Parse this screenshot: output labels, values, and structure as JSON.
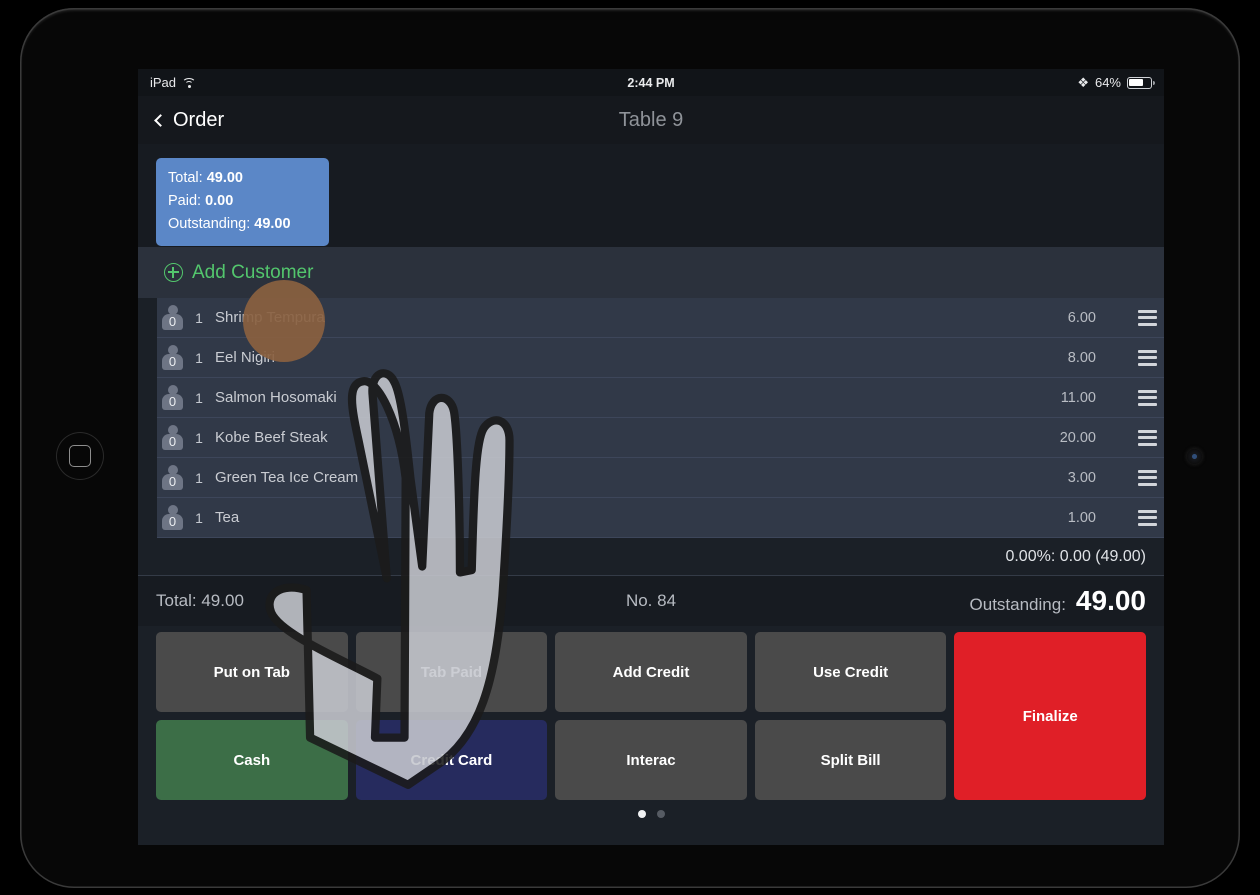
{
  "status_bar": {
    "device": "iPad",
    "wifi_icon": "wifi-icon",
    "time": "2:44 PM",
    "bluetooth_icon": "bluetooth-icon",
    "battery_percent": "64%",
    "battery_icon": "battery-icon"
  },
  "nav_bar": {
    "back_icon": "chevron-left-icon",
    "back_label": "Order",
    "title": "Table 9"
  },
  "totals_box": {
    "total_label": "Total:",
    "total_value": "49.00",
    "paid_label": "Paid:",
    "paid_value": "0.00",
    "outstanding_label": "Outstanding:",
    "outstanding_value": "49.00",
    "color": "#5b87c7"
  },
  "add_customer": {
    "icon": "plus-circle-icon",
    "label": "Add Customer",
    "color": "#53c66d"
  },
  "order_items": [
    {
      "seat": "0",
      "qty": "1",
      "name": "Shrimp Tempura",
      "price": "6.00",
      "menu_icon": "hamburger-menu-icon"
    },
    {
      "seat": "0",
      "qty": "1",
      "name": "Eel Nigiri",
      "price": "8.00",
      "menu_icon": "hamburger-menu-icon"
    },
    {
      "seat": "0",
      "qty": "1",
      "name": "Salmon Hosomaki",
      "price": "11.00",
      "menu_icon": "hamburger-menu-icon"
    },
    {
      "seat": "0",
      "qty": "1",
      "name": "Kobe Beef Steak",
      "price": "20.00",
      "menu_icon": "hamburger-menu-icon"
    },
    {
      "seat": "0",
      "qty": "1",
      "name": "Green Tea Ice Cream",
      "price": "3.00",
      "menu_icon": "hamburger-menu-icon"
    },
    {
      "seat": "0",
      "qty": "1",
      "name": "Tea",
      "price": "1.00",
      "menu_icon": "hamburger-menu-icon"
    }
  ],
  "tax_row": "0.00%: 0.00 (49.00)",
  "summary": {
    "total": "Total: 49.00",
    "order_number": "No. 84",
    "outstanding_label": "Outstanding:",
    "outstanding_value": "49.00"
  },
  "buttons": [
    {
      "label": "Put on Tab",
      "style": "grey"
    },
    {
      "label": "Tab Paid",
      "style": "grey"
    },
    {
      "label": "Add Credit",
      "style": "grey"
    },
    {
      "label": "Use Credit",
      "style": "grey"
    },
    {
      "label": "Finalize",
      "style": "finalize"
    },
    {
      "label": "Cash",
      "style": "cash"
    },
    {
      "label": "Credit Card",
      "style": "credit"
    },
    {
      "label": "Interac",
      "style": "grey"
    },
    {
      "label": "Split Bill",
      "style": "grey"
    }
  ],
  "pagination": {
    "total": 2,
    "active": 1
  }
}
